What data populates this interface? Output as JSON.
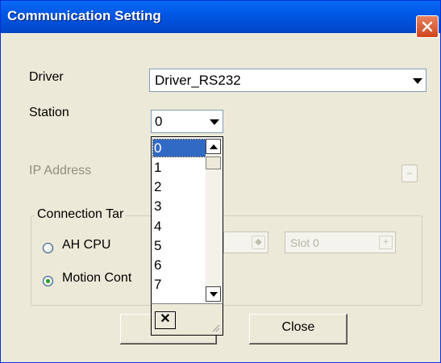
{
  "window": {
    "title": "Communication Setting"
  },
  "fields": {
    "driver_label": "Driver",
    "driver_value": "Driver_RS232",
    "station_label": "Station",
    "station_value": "0",
    "ip_label": "IP Address"
  },
  "station_dropdown": {
    "items": [
      "0",
      "1",
      "2",
      "3",
      "4",
      "5",
      "6",
      "7"
    ],
    "selected": "0",
    "clear_label": "✕"
  },
  "connection_target": {
    "group_label": "Connection Tar",
    "options": [
      {
        "label": "AH CPU",
        "checked": false
      },
      {
        "label": "Motion Cont",
        "checked": true
      }
    ],
    "slot_value": "Slot 0"
  },
  "buttons": {
    "close_label": "Close"
  },
  "colors": {
    "titlebar": "#0058E6",
    "dialog_bg": "#ECE9D8",
    "selection": "#316AC5",
    "close_red": "#D0441C"
  }
}
